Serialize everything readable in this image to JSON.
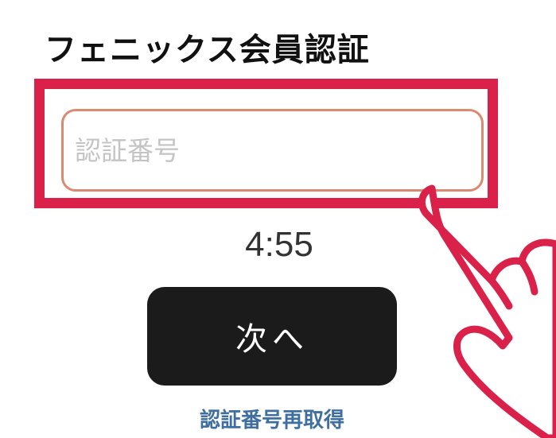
{
  "header": {
    "title": "フェニックス会員認証"
  },
  "form": {
    "code_input": {
      "value": "",
      "placeholder": "認証番号"
    },
    "timer": "4:55",
    "next_button_label": "次へ",
    "resend_link_label": "認証番号再取得"
  },
  "overlay": {
    "highlight_color": "#d9214a",
    "pointer_icon": "pointing-hand-icon"
  }
}
